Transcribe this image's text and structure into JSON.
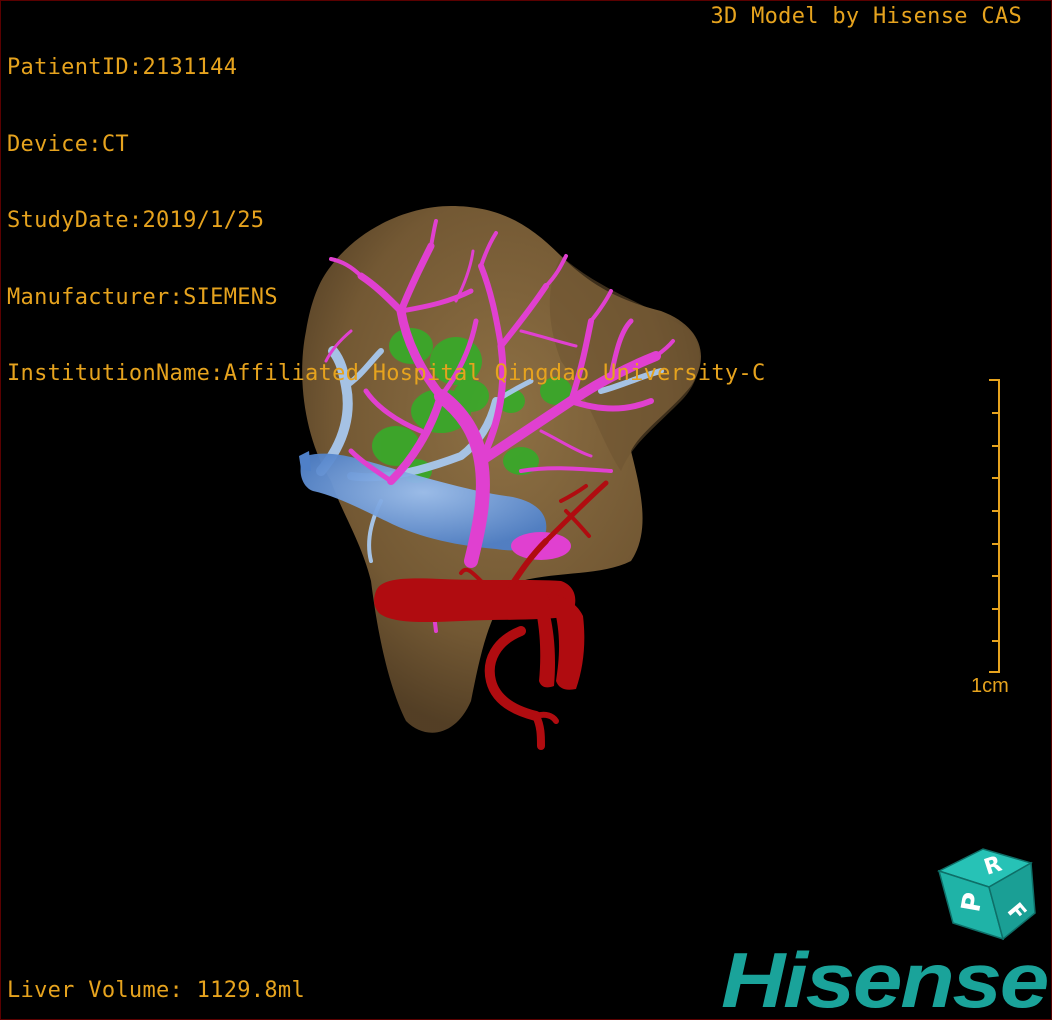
{
  "header": {
    "patient_id": "PatientID:2131144",
    "device": "Device:CT",
    "study_date": "StudyDate:2019/1/25",
    "manufacturer": "Manufacturer:SIEMENS",
    "institution": "InstitutionName:Affiliated Hospital Qingdao University-C"
  },
  "credit": "3D Model by Hisense CAS",
  "footer": {
    "liver_volume": "Liver Volume: 1129.8ml"
  },
  "scale_bar": {
    "label": "1cm",
    "tick_count": 10
  },
  "orientation_cube": {
    "faces": [
      "R",
      "P",
      "F"
    ]
  },
  "logo": {
    "text": "Hisense"
  },
  "colors": {
    "overlay_text": "#e6a31e",
    "liver": "#8a6a3e",
    "portal_vein": "#e040d0",
    "hepatic_vein": "#a8c8ee",
    "ivc": "#6f9fe0",
    "lesions": "#3aa82a",
    "artery": "#b00c10",
    "logo": "#1aa39a"
  },
  "structures": [
    "liver",
    "portal-vein",
    "hepatic-vein",
    "inferior-vena-cava",
    "lesions",
    "hepatic-artery"
  ]
}
